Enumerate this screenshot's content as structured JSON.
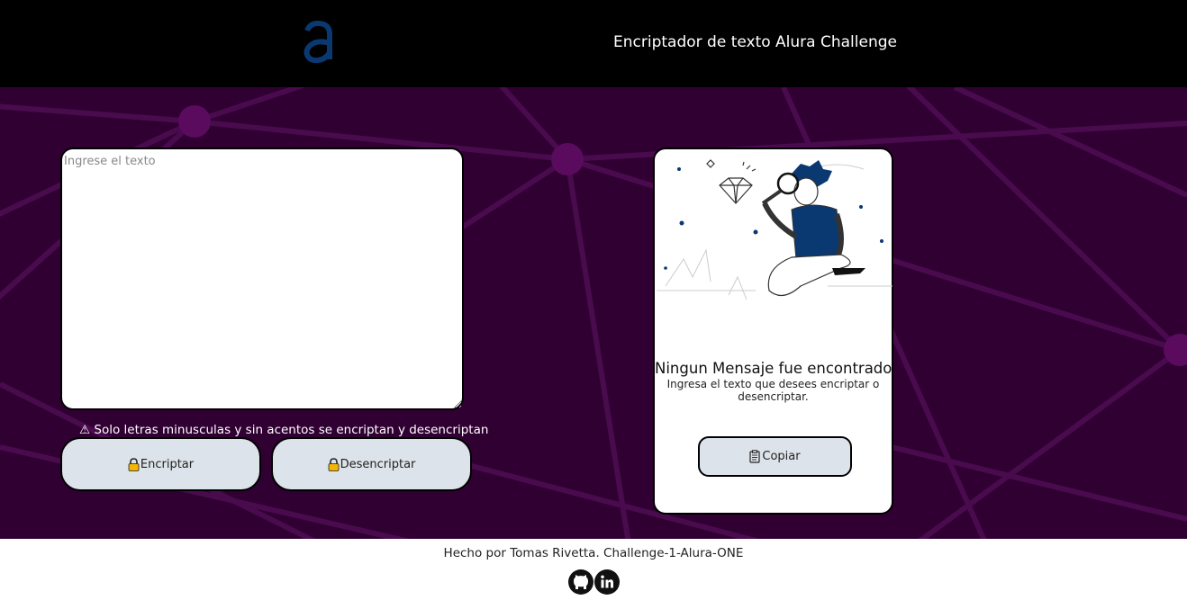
{
  "header": {
    "logo_icon": "alura-logo-icon",
    "logo_color": "#0a3871",
    "title": "Encriptador de texto Alura Challenge"
  },
  "main": {
    "background_color": "#300033",
    "input": {
      "placeholder": "Ingrese el texto",
      "value": ""
    },
    "warning": "⚠ Solo letras minusculas y sin acentos se encriptan y desencriptan",
    "buttons": {
      "encrypt_label": "Encriptar",
      "encrypt_icon": "lock-icon",
      "decrypt_label": "Desencriptar",
      "decrypt_icon": "lock-icon"
    },
    "output": {
      "title": "Ningun Mensaje fue encontrado",
      "subtitle": "Ingresa el texto que desees encriptar o desencriptar.",
      "copy_label": "Copiar",
      "copy_icon": "clipboard-icon"
    }
  },
  "footer": {
    "text": "Hecho por Tomas Rivetta. Challenge-1-Alura-ONE",
    "icons": [
      "github-icon",
      "linkedin-icon"
    ]
  }
}
